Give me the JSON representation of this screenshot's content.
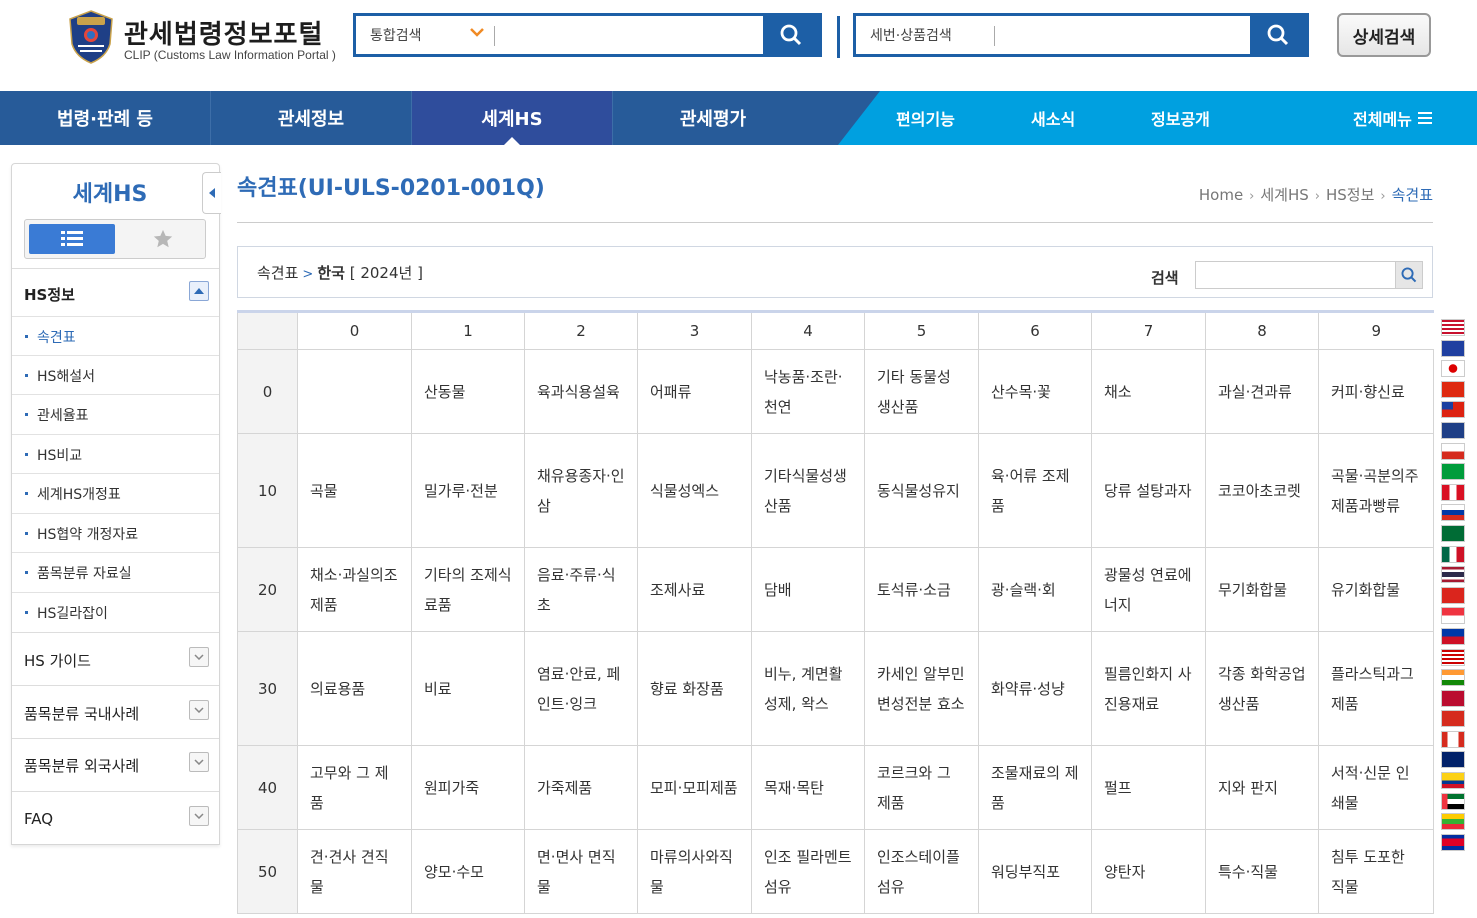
{
  "header": {
    "logo_title": "관세법령정보포털",
    "logo_subtitle": "CLIP (Customs Law Information Portal )",
    "logo_emblem": "korea-customs-service-emblem",
    "search1": {
      "type_label": "통합검색",
      "value": ""
    },
    "search2": {
      "type_label": "세번·상품검색",
      "value": ""
    },
    "detail_search_label": "상세검색"
  },
  "nav": {
    "items": [
      {
        "label": "법령·판례 등"
      },
      {
        "label": "관세정보"
      },
      {
        "label": "세계HS",
        "active": true
      },
      {
        "label": "관세평가"
      }
    ],
    "sub_items": [
      {
        "label": "편의기능"
      },
      {
        "label": "새소식"
      },
      {
        "label": "정보공개"
      }
    ],
    "all_menu_label": "전체메뉴",
    "colors": {
      "main": "#275b99",
      "active": "#2f4d9c",
      "sub": "#00a0e0"
    }
  },
  "sidebar": {
    "title": "세계HS",
    "section_active": {
      "label": "HS정보",
      "expanded": true
    },
    "sub_items": [
      {
        "label": "속견표"
      },
      {
        "label": "HS해설서"
      },
      {
        "label": "관세율표"
      },
      {
        "label": "HS비교"
      },
      {
        "label": "세계HS개정표"
      },
      {
        "label": "HS협약 개정자료"
      },
      {
        "label": "품목분류 자료실"
      },
      {
        "label": "HS길라잡이"
      }
    ],
    "sections": [
      {
        "label": "HS 가이드"
      },
      {
        "label": "품목분류 국내사례"
      },
      {
        "label": "품목분류 외국사례"
      },
      {
        "label": "FAQ"
      }
    ]
  },
  "page": {
    "title": "속견표(UI-ULS-0201-001Q)",
    "breadcrumb": [
      "Home",
      "세계HS",
      "HS정보",
      "속견표"
    ]
  },
  "filter": {
    "path_root": "속견표",
    "path_country": "한국",
    "path_year": "[ 2024년 ]",
    "search_label": "검색",
    "search_value": ""
  },
  "table": {
    "columns": [
      "0",
      "1",
      "2",
      "3",
      "4",
      "5",
      "6",
      "7",
      "8",
      "9"
    ],
    "rows": [
      {
        "head": "0",
        "cells": [
          "",
          "산동물",
          "육과식용설육",
          "어패류",
          "낙농품·조란·천연",
          "기타 동물성 생산품",
          "산수목·꽃",
          "채소",
          "과실·견과류",
          "커피·향신료"
        ]
      },
      {
        "head": "10",
        "cells": [
          "곡물",
          "밀가루·전분",
          "채유용종자·인삼",
          "식물성엑스",
          "기타식물성생산품",
          "동식물성유지",
          "육·어류 조제품",
          "당류 설탕과자",
          "코코아초코렛",
          "곡물·곡분의주제품과빵류"
        ]
      },
      {
        "head": "20",
        "cells": [
          "채소·과실의조제품",
          "기타의 조제식료품",
          "음료·주류·식초",
          "조제사료",
          "담배",
          "토석류·소금",
          "광·슬랙·회",
          "광물성 연료에너지",
          "무기화합물",
          "유기화합물"
        ]
      },
      {
        "head": "30",
        "cells": [
          "의료용품",
          "비료",
          "염료·안료, 페인트·잉크",
          "향료 화장품",
          "비누, 계면활성제, 왁스",
          "카세인 알부민 변성전분 효소",
          "화약류·성냥",
          "필름인화지 사진용재료",
          "각종 화학공업 생산품",
          "플라스틱과그제품"
        ]
      },
      {
        "head": "40",
        "cells": [
          "고무와 그 제품",
          "원피가죽",
          "가죽제품",
          "모피·모피제품",
          "목재·목탄",
          "코르크와 그 제품",
          "조물재료의 제품",
          "펄프",
          "지와 판지",
          "서적·신문 인쇄물"
        ]
      },
      {
        "head": "50",
        "cells": [
          "견·견사 견직물",
          "양모·수모",
          "면·면사 면직물",
          "마류의사와직물",
          "인조 필라멘트 섬유",
          "인조스테이플 섬유",
          "워딩부직포",
          "양탄자",
          "특수·직물",
          "침투 도포한 직물"
        ]
      }
    ]
  },
  "flags": [
    "us",
    "eu",
    "jp",
    "cn",
    "tw",
    "au",
    "cl",
    "br",
    "pe",
    "ru",
    "sa",
    "mx",
    "th",
    "vn",
    "sg",
    "ph",
    "my",
    "in",
    "no",
    "ch",
    "ca",
    "nz",
    "co",
    "ae",
    "mm",
    "kh"
  ]
}
